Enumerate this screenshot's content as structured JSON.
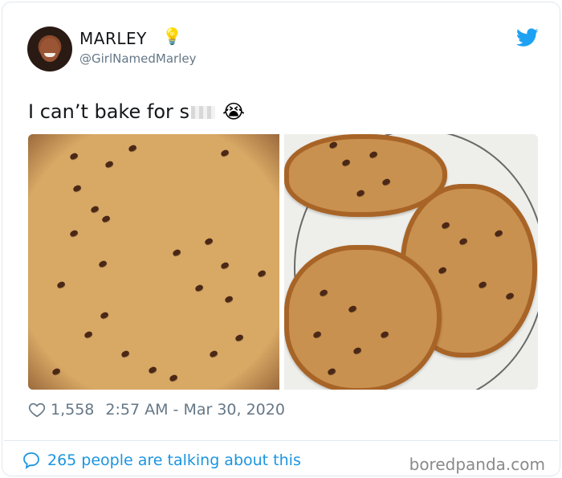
{
  "author": {
    "name": "MARLEY",
    "handle": "@GirlNamedMarley",
    "avatar_icon": "profile-photo",
    "name_emoji": "light-bulb-icon"
  },
  "tweet": {
    "text": "I can’t bake for s",
    "emoji": "crying-face-emoji"
  },
  "footer": {
    "likes": "1,558",
    "timestamp": "2:57 AM - Mar 30, 2020",
    "conversation": "265 people are talking about this",
    "watermark": "boredpanda.com"
  },
  "colors": {
    "twitter_blue": "#1da1f2",
    "link_blue": "#1b95e0",
    "secondary_text": "#657786"
  }
}
